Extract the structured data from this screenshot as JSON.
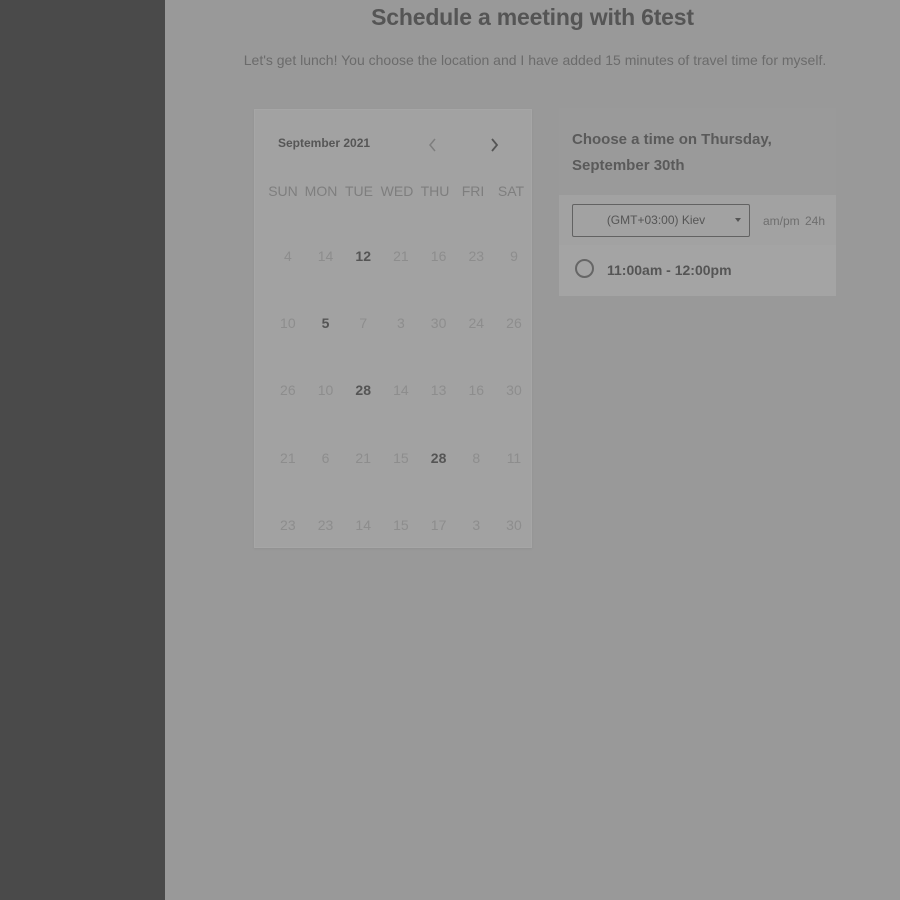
{
  "header": {
    "title": "Schedule a meeting with 6test",
    "subtitle": "Let's get lunch! You choose the location and I have added 15 minutes of travel time for myself."
  },
  "calendar": {
    "month_label": "September 2021",
    "weekdays": [
      "SUN",
      "MON",
      "TUE",
      "WED",
      "THU",
      "FRI",
      "SAT"
    ],
    "weeks": [
      [
        {
          "d": "4",
          "a": false
        },
        {
          "d": "14",
          "a": false
        },
        {
          "d": "12",
          "a": true
        },
        {
          "d": "21",
          "a": false
        },
        {
          "d": "16",
          "a": false
        },
        {
          "d": "23",
          "a": false
        },
        {
          "d": "9",
          "a": false
        }
      ],
      [
        {
          "d": "10",
          "a": false
        },
        {
          "d": "5",
          "a": true
        },
        {
          "d": "7",
          "a": false
        },
        {
          "d": "3",
          "a": false
        },
        {
          "d": "30",
          "a": false
        },
        {
          "d": "24",
          "a": false
        },
        {
          "d": "26",
          "a": false
        }
      ],
      [
        {
          "d": "26",
          "a": false
        },
        {
          "d": "10",
          "a": false
        },
        {
          "d": "28",
          "a": true
        },
        {
          "d": "14",
          "a": false
        },
        {
          "d": "13",
          "a": false
        },
        {
          "d": "16",
          "a": false
        },
        {
          "d": "30",
          "a": false
        }
      ],
      [
        {
          "d": "21",
          "a": false
        },
        {
          "d": "6",
          "a": false
        },
        {
          "d": "21",
          "a": false
        },
        {
          "d": "15",
          "a": false
        },
        {
          "d": "28",
          "a": true
        },
        {
          "d": "8",
          "a": false
        },
        {
          "d": "11",
          "a": false
        }
      ],
      [
        {
          "d": "23",
          "a": false
        },
        {
          "d": "23",
          "a": false
        },
        {
          "d": "14",
          "a": false
        },
        {
          "d": "15",
          "a": false
        },
        {
          "d": "17",
          "a": false
        },
        {
          "d": "3",
          "a": false
        },
        {
          "d": "30",
          "a": false
        }
      ]
    ]
  },
  "time_panel": {
    "heading": "Choose a time on Thursday, September 30th",
    "timezone": "(GMT+03:00) Kiev",
    "format_ampm": "am/pm",
    "format_24h": "24h",
    "slots": [
      "11:00am - 12:00pm"
    ]
  },
  "colors": {
    "sidebar": "#4a4a4a",
    "page_background": "#999999",
    "card_background": "#a2a2a2"
  },
  "icons": {
    "prev": "chevron-left-icon",
    "next": "chevron-right-icon",
    "dropdown": "caret-down-icon",
    "slot": "radio-circle-icon"
  }
}
